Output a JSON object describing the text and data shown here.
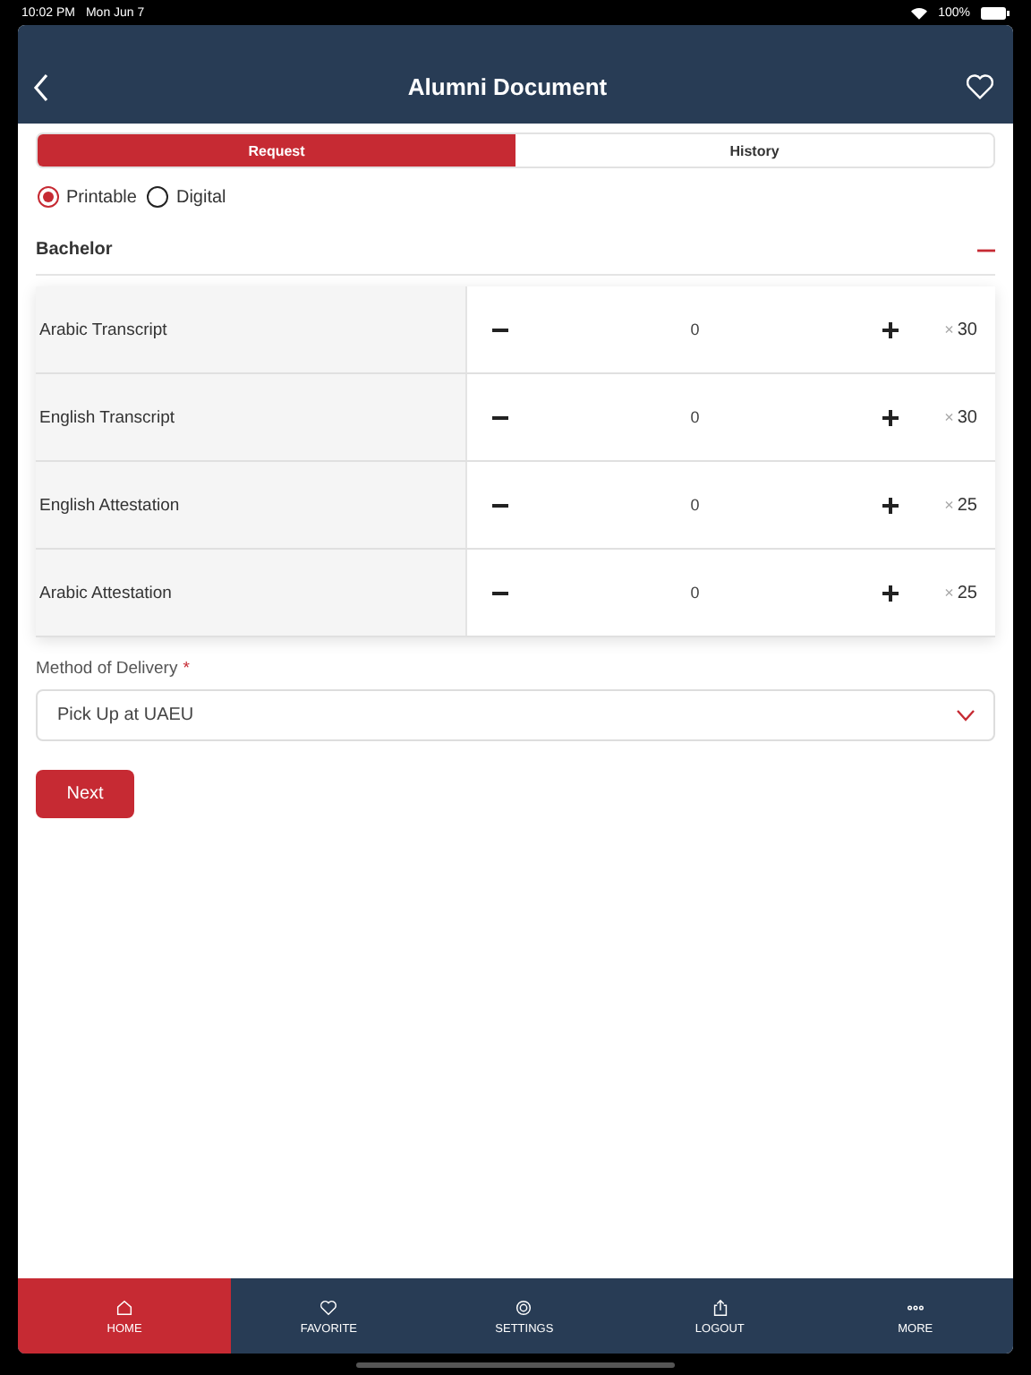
{
  "status_bar": {
    "time": "10:02 PM",
    "date": "Mon Jun 7",
    "battery": "100%"
  },
  "header": {
    "title": "Alumni Document"
  },
  "tabs": [
    {
      "label": "Request",
      "selected": true
    },
    {
      "label": "History",
      "selected": false
    }
  ],
  "format_options": [
    {
      "label": "Printable",
      "selected": true
    },
    {
      "label": "Digital",
      "selected": false
    }
  ],
  "section": {
    "title": "Bachelor",
    "expanded": true,
    "rows": [
      {
        "name": "Arabic Transcript",
        "quantity": "0",
        "times": "×",
        "price": "30"
      },
      {
        "name": "English Transcript",
        "quantity": "0",
        "times": "×",
        "price": "30"
      },
      {
        "name": "English Attestation",
        "quantity": "0",
        "times": "×",
        "price": "25"
      },
      {
        "name": "Arabic Attestation",
        "quantity": "0",
        "times": "×",
        "price": "25"
      }
    ]
  },
  "delivery": {
    "label": "Method of Delivery",
    "required_mark": "*",
    "value": "Pick Up at UAEU"
  },
  "next_button": "Next",
  "bottom_nav": [
    {
      "kind": "home",
      "label": "HOME",
      "selected": true
    },
    {
      "kind": "favorite",
      "label": "FAVORITE",
      "selected": false
    },
    {
      "kind": "settings",
      "label": "SETTINGS",
      "selected": false
    },
    {
      "kind": "logout",
      "label": "LOGOUT",
      "selected": false
    },
    {
      "kind": "more",
      "label": "MORE",
      "selected": false
    }
  ]
}
